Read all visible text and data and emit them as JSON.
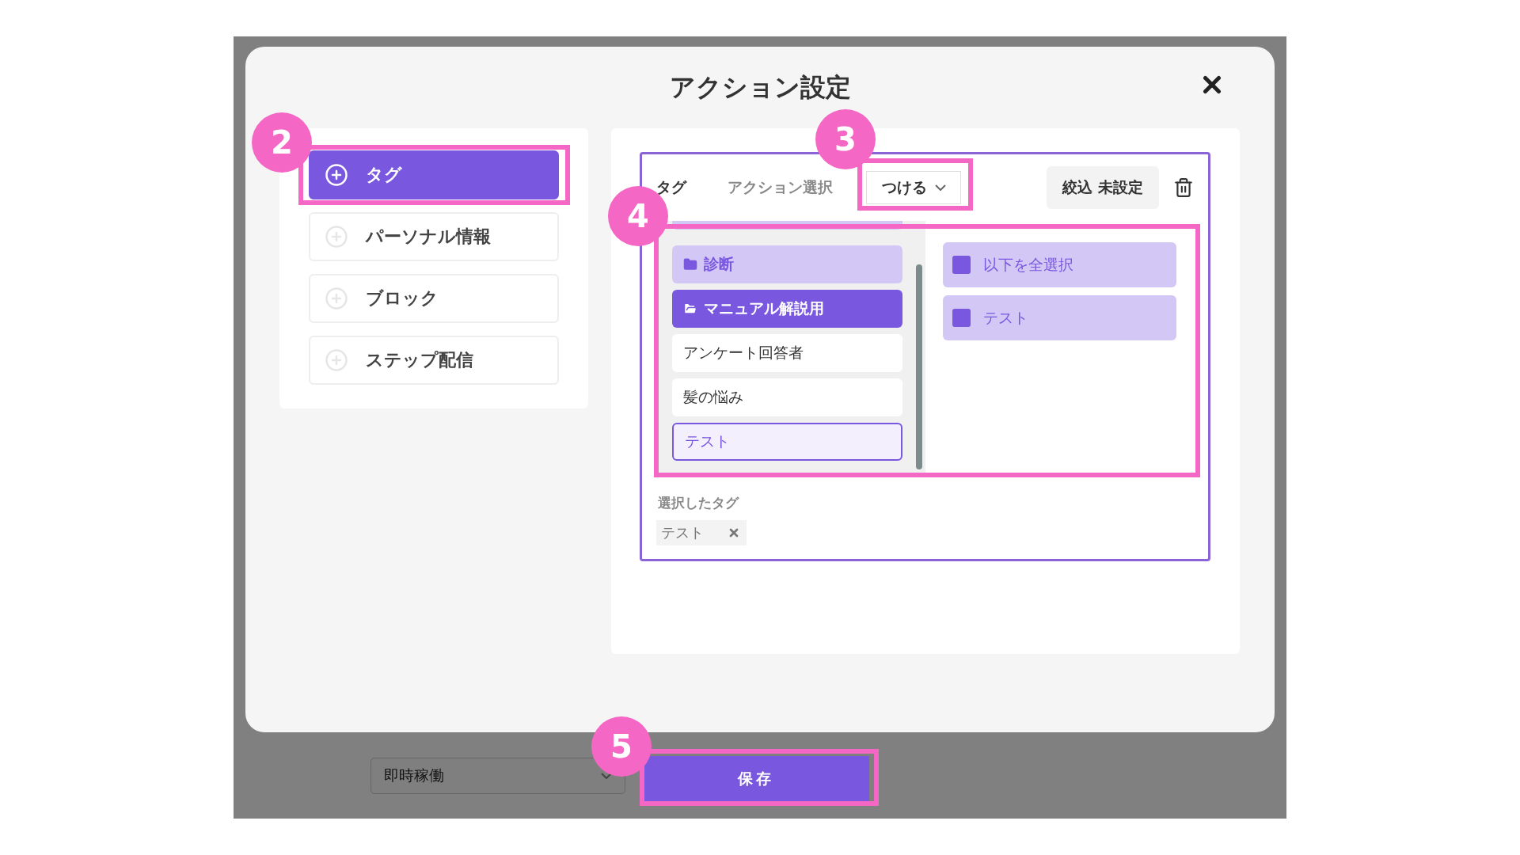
{
  "modal": {
    "title": "アクション設定"
  },
  "categories": [
    {
      "label": "タグ",
      "selected": true
    },
    {
      "label": "パーソナル情報",
      "selected": false
    },
    {
      "label": "ブロック",
      "selected": false
    },
    {
      "label": "ステップ配信",
      "selected": false
    }
  ],
  "action": {
    "type_label": "タグ",
    "select_label": "アクション選択",
    "dropdown_value": "つける",
    "filter_button": "絞込 未設定"
  },
  "tag_list": [
    {
      "label": "診断",
      "kind": "folder",
      "selected": false
    },
    {
      "label": "マニュアル解説用",
      "kind": "folder",
      "selected": true
    },
    {
      "label": "アンケート回答者",
      "kind": "tag",
      "selected": false
    },
    {
      "label": "髪の悩み",
      "kind": "tag",
      "selected": false
    },
    {
      "label": "テスト",
      "kind": "tag",
      "selected": true
    }
  ],
  "tag_options": [
    {
      "label": "以下を全選択",
      "checked": true
    },
    {
      "label": "テスト",
      "checked": true
    }
  ],
  "selected_tags": {
    "label": "選択したタグ",
    "chips": [
      "テスト"
    ]
  },
  "footer": {
    "schedule": "即時稼働",
    "save": "保存"
  },
  "annotations": [
    {
      "number": "2"
    },
    {
      "number": "3"
    },
    {
      "number": "4"
    },
    {
      "number": "5"
    }
  ]
}
